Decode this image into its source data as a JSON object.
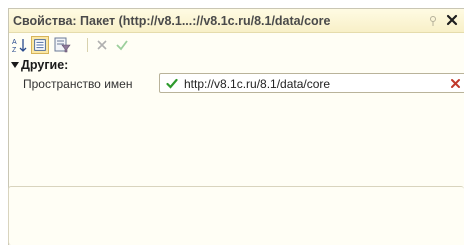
{
  "window": {
    "title": "Свойства: Пакет (http://v8.1...://v8.1c.ru/8.1/data/core"
  },
  "toolbar": {
    "buttons": [
      {
        "icon": "sort-az-icon"
      },
      {
        "icon": "categories-view-icon"
      },
      {
        "icon": "filter-icon"
      },
      {
        "icon": "delete-icon"
      },
      {
        "icon": "apply-check-icon"
      }
    ]
  },
  "group": {
    "label": "Другие:",
    "expanded": true
  },
  "properties": [
    {
      "label": "Пространство имен",
      "value": "http://v8.1c.ru/8.1/data/core"
    }
  ],
  "colors": {
    "title_bg": "#fbf4d2",
    "panel_bg": "#fffef5",
    "check_green": "#2e9a2e",
    "close_red": "#c0392b"
  }
}
